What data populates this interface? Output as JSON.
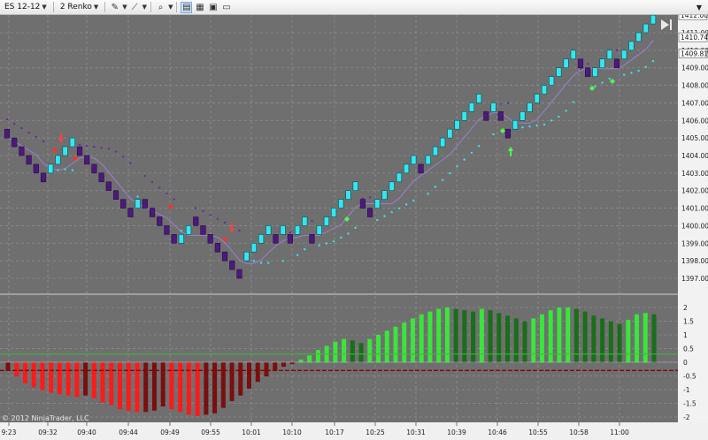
{
  "toolbar": {
    "instrument": "ES 12-12",
    "bar_type": "2 Renko",
    "icons": [
      "pencil-icon",
      "ruler-icon",
      "zoom-icon",
      "properties-icon",
      "data-box-icon",
      "chart-trader-icon",
      "screenshot-icon"
    ]
  },
  "price_axis": {
    "ticks": [
      "1411.00",
      "1410.00",
      "1409.00",
      "1408.00",
      "1407.00",
      "1406.00",
      "1405.00",
      "1404.00",
      "1403.00",
      "1402.00",
      "1401.00",
      "1400.00",
      "1399.00",
      "1398.00",
      "1397.00"
    ],
    "flags": [
      "1412.00",
      "1410.74",
      "1409.81"
    ]
  },
  "osc_axis": {
    "ticks": [
      "2",
      "1.5",
      "1",
      "0.5",
      "0",
      "-0.5",
      "-1",
      "-1.5",
      "-2"
    ]
  },
  "time_axis": {
    "ticks": [
      "9:23",
      "09:32",
      "09:40",
      "09:44",
      "09:49",
      "09:55",
      "10:01",
      "10:10",
      "10:17",
      "10:25",
      "10:31",
      "10:39",
      "10:46",
      "10:55",
      "10:58",
      "11:00"
    ]
  },
  "copyright": "© 2012 NinjaTrader, LLC",
  "colors": {
    "chart_bg": "#6f6f6f",
    "down_brick": "#4b1a7a",
    "up_brick": "#35e6ef",
    "osc_up_light": "#39e639",
    "osc_up_dark": "#1a6e1a",
    "osc_down_light": "#ff1a1a",
    "osc_down_dark": "#7a0f0f"
  },
  "chart_data": {
    "type": "bar",
    "title": "",
    "ylim": [
      1396.5,
      1412.5
    ],
    "brick_size": 0.5,
    "bricks": [
      {
        "o": 1405.5,
        "c": 1405
      },
      {
        "o": 1405,
        "c": 1404.5
      },
      {
        "o": 1404.5,
        "c": 1404
      },
      {
        "o": 1404,
        "c": 1403.5
      },
      {
        "o": 1403.5,
        "c": 1403
      },
      {
        "o": 1403,
        "c": 1402.5
      },
      {
        "o": 1403,
        "c": 1403.5
      },
      {
        "o": 1403.5,
        "c": 1404
      },
      {
        "o": 1404,
        "c": 1404.5
      },
      {
        "o": 1404.5,
        "c": 1405
      },
      {
        "o": 1404.5,
        "c": 1404
      },
      {
        "o": 1404,
        "c": 1403.5
      },
      {
        "o": 1403.5,
        "c": 1403
      },
      {
        "o": 1403,
        "c": 1402.5
      },
      {
        "o": 1402.5,
        "c": 1402
      },
      {
        "o": 1402,
        "c": 1401.5
      },
      {
        "o": 1401.5,
        "c": 1401
      },
      {
        "o": 1401,
        "c": 1400.5
      },
      {
        "o": 1401,
        "c": 1401.5
      },
      {
        "o": 1401.5,
        "c": 1401
      },
      {
        "o": 1401,
        "c": 1400.5
      },
      {
        "o": 1400.5,
        "c": 1400
      },
      {
        "o": 1400,
        "c": 1399.5
      },
      {
        "o": 1399.5,
        "c": 1399
      },
      {
        "o": 1399,
        "c": 1399.5
      },
      {
        "o": 1399.5,
        "c": 1400
      },
      {
        "o": 1400.5,
        "c": 1400
      },
      {
        "o": 1400,
        "c": 1399.5
      },
      {
        "o": 1399.5,
        "c": 1399
      },
      {
        "o": 1399,
        "c": 1398.5
      },
      {
        "o": 1398.5,
        "c": 1398
      },
      {
        "o": 1398,
        "c": 1397.5
      },
      {
        "o": 1397.5,
        "c": 1397
      },
      {
        "o": 1398,
        "c": 1398.5
      },
      {
        "o": 1398.5,
        "c": 1399
      },
      {
        "o": 1399,
        "c": 1399.5
      },
      {
        "o": 1399.5,
        "c": 1400
      },
      {
        "o": 1399.5,
        "c": 1399
      },
      {
        "o": 1399.5,
        "c": 1400
      },
      {
        "o": 1399.5,
        "c": 1399
      },
      {
        "o": 1399.5,
        "c": 1400
      },
      {
        "o": 1400,
        "c": 1400.5
      },
      {
        "o": 1399.5,
        "c": 1399
      },
      {
        "o": 1399.5,
        "c": 1400
      },
      {
        "o": 1400,
        "c": 1400.5
      },
      {
        "o": 1400.5,
        "c": 1401
      },
      {
        "o": 1401,
        "c": 1401.5
      },
      {
        "o": 1401.5,
        "c": 1402
      },
      {
        "o": 1402,
        "c": 1402.5
      },
      {
        "o": 1401.5,
        "c": 1401
      },
      {
        "o": 1401,
        "c": 1400.5
      },
      {
        "o": 1401,
        "c": 1401.5
      },
      {
        "o": 1401.5,
        "c": 1402
      },
      {
        "o": 1402,
        "c": 1402.5
      },
      {
        "o": 1402.5,
        "c": 1403
      },
      {
        "o": 1403,
        "c": 1403.5
      },
      {
        "o": 1403.5,
        "c": 1404
      },
      {
        "o": 1403.5,
        "c": 1403
      },
      {
        "o": 1403.5,
        "c": 1404
      },
      {
        "o": 1404,
        "c": 1404.5
      },
      {
        "o": 1404.5,
        "c": 1405
      },
      {
        "o": 1405,
        "c": 1405.5
      },
      {
        "o": 1405.5,
        "c": 1406
      },
      {
        "o": 1406,
        "c": 1406.5
      },
      {
        "o": 1406.5,
        "c": 1407
      },
      {
        "o": 1407,
        "c": 1407.5
      },
      {
        "o": 1406.5,
        "c": 1406
      },
      {
        "o": 1406.5,
        "c": 1407
      },
      {
        "o": 1406.5,
        "c": 1406
      },
      {
        "o": 1405.5,
        "c": 1405
      },
      {
        "o": 1405.5,
        "c": 1406
      },
      {
        "o": 1406,
        "c": 1406.5
      },
      {
        "o": 1406.5,
        "c": 1407
      },
      {
        "o": 1407,
        "c": 1407.5
      },
      {
        "o": 1407.5,
        "c": 1408
      },
      {
        "o": 1408,
        "c": 1408.5
      },
      {
        "o": 1408.5,
        "c": 1409
      },
      {
        "o": 1409,
        "c": 1409.5
      },
      {
        "o": 1409.5,
        "c": 1410
      },
      {
        "o": 1409.5,
        "c": 1409
      },
      {
        "o": 1409,
        "c": 1408.5
      },
      {
        "o": 1408.5,
        "c": 1409
      },
      {
        "o": 1409,
        "c": 1409.5
      },
      {
        "o": 1409.5,
        "c": 1410
      },
      {
        "o": 1409.5,
        "c": 1409
      },
      {
        "o": 1409.5,
        "c": 1410
      },
      {
        "o": 1410,
        "c": 1410.5
      },
      {
        "o": 1410.5,
        "c": 1411
      },
      {
        "o": 1411,
        "c": 1411.5
      },
      {
        "o": 1411.5,
        "c": 1412
      }
    ],
    "oscillator": {
      "ylim": [
        -2.1,
        2.4
      ],
      "zero_line": 0,
      "signal_lines": [
        0.3,
        -0.3
      ],
      "values": [
        -0.3,
        -0.5,
        -0.75,
        -0.9,
        -1.0,
        -1.1,
        -1.15,
        -1.2,
        -1.25,
        -1.2,
        -1.3,
        -1.45,
        -1.55,
        -1.7,
        -1.75,
        -1.8,
        -1.8,
        -1.75,
        -1.6,
        -1.7,
        -1.8,
        -1.9,
        -1.95,
        -1.9,
        -1.85,
        -1.65,
        -1.4,
        -1.2,
        -0.95,
        -0.7,
        -0.5,
        -0.3,
        -0.15,
        -0.05,
        0.1,
        0.25,
        0.45,
        0.6,
        0.75,
        0.85,
        0.8,
        0.7,
        0.85,
        1.0,
        1.15,
        1.3,
        1.45,
        1.6,
        1.75,
        1.85,
        1.95,
        2.0,
        1.95,
        1.9,
        1.85,
        1.95,
        1.9,
        1.8,
        1.7,
        1.6,
        1.5,
        1.6,
        1.75,
        1.9,
        2.0,
        2.0,
        1.95,
        1.85,
        1.7,
        1.6,
        1.5,
        1.4,
        1.55,
        1.75,
        1.8,
        1.75
      ]
    }
  }
}
